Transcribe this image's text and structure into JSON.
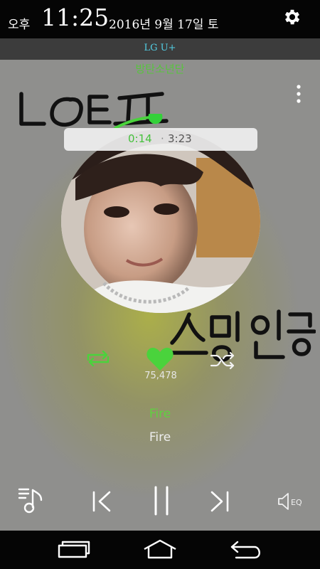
{
  "status_bar": {
    "ampm": "오후",
    "time": "11:25",
    "date": "2016년 9월 17일 토",
    "settings_icon": "gear-icon"
  },
  "carrier": "LG U+",
  "player": {
    "artist": "방탄소년단",
    "elapsed": "0:14",
    "separator": "·",
    "duration": "3:23",
    "progress_fraction": 0.069,
    "like_count": "75,478",
    "liked": true,
    "song_title": "Fire",
    "album_title": "Fire",
    "accent_color": "#4ad33c"
  },
  "handwriting": {
    "top": "LOE프",
    "bottom": "스밍인증"
  },
  "controls": {
    "playlist_icon": "playlist-icon",
    "prev_icon": "previous-icon",
    "pause_icon": "pause-icon",
    "next_icon": "next-icon",
    "eq_label": "EQ"
  },
  "nav_bar": {
    "back_icon": "back-icon",
    "home_icon": "home-icon",
    "recent_icon": "recent-apps-icon"
  }
}
